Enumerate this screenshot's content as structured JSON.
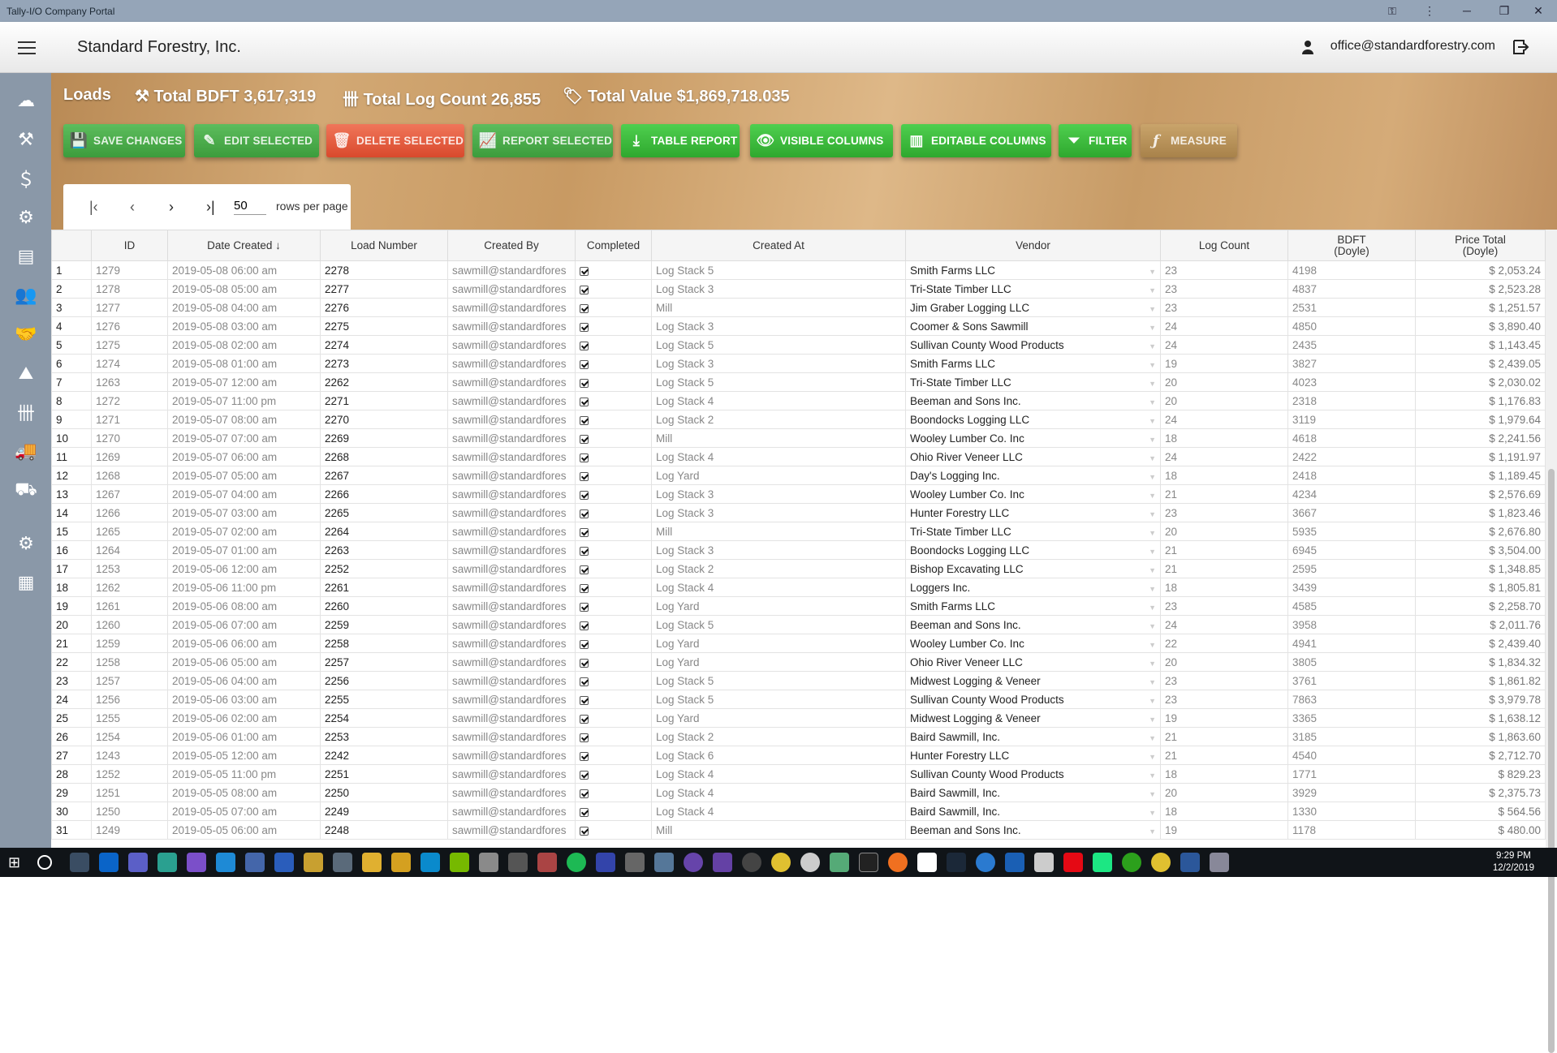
{
  "window": {
    "title": "Tally-I/O Company Portal"
  },
  "header": {
    "company": "Standard Forestry, Inc.",
    "user_email": "office@standardforestry.com"
  },
  "summary": {
    "section": "Loads",
    "total_bdft": "Total BDFT 3,617,319",
    "total_log_count": "Total Log Count 26,855",
    "total_value": "Total Value $1,869,718.035"
  },
  "toolbar": {
    "save": "SAVE CHANGES",
    "edit": "EDIT SELECTED",
    "delete": "DELETE SELECTED",
    "report": "REPORT SELECTED",
    "table_report": "TABLE REPORT",
    "visible_columns": "VISIBLE COLUMNS",
    "editable_columns": "EDITABLE COLUMNS",
    "filter": "FILTER",
    "measure": "MEASURE"
  },
  "pagination": {
    "rows_per_page_value": "50",
    "rows_per_page_label": "rows per page"
  },
  "table": {
    "headers": {
      "id": "ID",
      "date_created": "Date Created",
      "load_number": "Load Number",
      "created_by": "Created By",
      "completed": "Completed",
      "created_at": "Created At",
      "vendor": "Vendor",
      "log_count": "Log Count",
      "bdft": "BDFT",
      "bdft_sub": "(Doyle)",
      "price_total": "Price Total",
      "price_sub": "(Doyle)"
    },
    "rows": [
      [
        "1",
        "1279",
        "2019-05-08 06:00 am",
        "2278",
        "sawmill@standardfores",
        "Log Stack 5",
        "Smith Farms LLC",
        "23",
        "4198",
        "$ 2,053.24"
      ],
      [
        "2",
        "1278",
        "2019-05-08 05:00 am",
        "2277",
        "sawmill@standardfores",
        "Log Stack 3",
        "Tri-State Timber LLC",
        "23",
        "4837",
        "$ 2,523.28"
      ],
      [
        "3",
        "1277",
        "2019-05-08 04:00 am",
        "2276",
        "sawmill@standardfores",
        "Mill",
        "Jim Graber Logging LLC",
        "23",
        "2531",
        "$ 1,251.57"
      ],
      [
        "4",
        "1276",
        "2019-05-08 03:00 am",
        "2275",
        "sawmill@standardfores",
        "Log Stack 3",
        "Coomer & Sons Sawmill",
        "24",
        "4850",
        "$ 3,890.40"
      ],
      [
        "5",
        "1275",
        "2019-05-08 02:00 am",
        "2274",
        "sawmill@standardfores",
        "Log Stack 5",
        "Sullivan County Wood Products",
        "24",
        "2435",
        "$ 1,143.45"
      ],
      [
        "6",
        "1274",
        "2019-05-08 01:00 am",
        "2273",
        "sawmill@standardfores",
        "Log Stack 3",
        "Smith Farms LLC",
        "19",
        "3827",
        "$ 2,439.05"
      ],
      [
        "7",
        "1263",
        "2019-05-07 12:00 am",
        "2262",
        "sawmill@standardfores",
        "Log Stack 5",
        "Tri-State Timber LLC",
        "20",
        "4023",
        "$ 2,030.02"
      ],
      [
        "8",
        "1272",
        "2019-05-07 11:00 pm",
        "2271",
        "sawmill@standardfores",
        "Log Stack 4",
        "Beeman and Sons Inc.",
        "20",
        "2318",
        "$ 1,176.83"
      ],
      [
        "9",
        "1271",
        "2019-05-07 08:00 am",
        "2270",
        "sawmill@standardfores",
        "Log Stack 2",
        "Boondocks Logging LLC",
        "24",
        "3119",
        "$ 1,979.64"
      ],
      [
        "10",
        "1270",
        "2019-05-07 07:00 am",
        "2269",
        "sawmill@standardfores",
        "Mill",
        "Wooley Lumber Co. Inc",
        "18",
        "4618",
        "$ 2,241.56"
      ],
      [
        "11",
        "1269",
        "2019-05-07 06:00 am",
        "2268",
        "sawmill@standardfores",
        "Log Stack 4",
        "Ohio River Veneer LLC",
        "24",
        "2422",
        "$ 1,191.97"
      ],
      [
        "12",
        "1268",
        "2019-05-07 05:00 am",
        "2267",
        "sawmill@standardfores",
        "Log Yard",
        "Day's Logging Inc.",
        "18",
        "2418",
        "$ 1,189.45"
      ],
      [
        "13",
        "1267",
        "2019-05-07 04:00 am",
        "2266",
        "sawmill@standardfores",
        "Log Stack 3",
        "Wooley Lumber Co. Inc",
        "21",
        "4234",
        "$ 2,576.69"
      ],
      [
        "14",
        "1266",
        "2019-05-07 03:00 am",
        "2265",
        "sawmill@standardfores",
        "Log Stack 3",
        "Hunter Forestry LLC",
        "23",
        "3667",
        "$ 1,823.46"
      ],
      [
        "15",
        "1265",
        "2019-05-07 02:00 am",
        "2264",
        "sawmill@standardfores",
        "Mill",
        "Tri-State Timber LLC",
        "20",
        "5935",
        "$ 2,676.80"
      ],
      [
        "16",
        "1264",
        "2019-05-07 01:00 am",
        "2263",
        "sawmill@standardfores",
        "Log Stack 3",
        "Boondocks Logging LLC",
        "21",
        "6945",
        "$ 3,504.00"
      ],
      [
        "17",
        "1253",
        "2019-05-06 12:00 am",
        "2252",
        "sawmill@standardfores",
        "Log Stack 2",
        "Bishop Excavating LLC",
        "21",
        "2595",
        "$ 1,348.85"
      ],
      [
        "18",
        "1262",
        "2019-05-06 11:00 pm",
        "2261",
        "sawmill@standardfores",
        "Log Stack 4",
        "Loggers Inc.",
        "18",
        "3439",
        "$ 1,805.81"
      ],
      [
        "19",
        "1261",
        "2019-05-06 08:00 am",
        "2260",
        "sawmill@standardfores",
        "Log Yard",
        "Smith Farms LLC",
        "23",
        "4585",
        "$ 2,258.70"
      ],
      [
        "20",
        "1260",
        "2019-05-06 07:00 am",
        "2259",
        "sawmill@standardfores",
        "Log Stack 5",
        "Beeman and Sons Inc.",
        "24",
        "3958",
        "$ 2,011.76"
      ],
      [
        "21",
        "1259",
        "2019-05-06 06:00 am",
        "2258",
        "sawmill@standardfores",
        "Log Yard",
        "Wooley Lumber Co. Inc",
        "22",
        "4941",
        "$ 2,439.40"
      ],
      [
        "22",
        "1258",
        "2019-05-06 05:00 am",
        "2257",
        "sawmill@standardfores",
        "Log Yard",
        "Ohio River Veneer LLC",
        "20",
        "3805",
        "$ 1,834.32"
      ],
      [
        "23",
        "1257",
        "2019-05-06 04:00 am",
        "2256",
        "sawmill@standardfores",
        "Log Stack 5",
        "Midwest Logging & Veneer",
        "23",
        "3761",
        "$ 1,861.82"
      ],
      [
        "24",
        "1256",
        "2019-05-06 03:00 am",
        "2255",
        "sawmill@standardfores",
        "Log Stack 5",
        "Sullivan County Wood Products",
        "23",
        "7863",
        "$ 3,979.78"
      ],
      [
        "25",
        "1255",
        "2019-05-06 02:00 am",
        "2254",
        "sawmill@standardfores",
        "Log Yard",
        "Midwest Logging & Veneer",
        "19",
        "3365",
        "$ 1,638.12"
      ],
      [
        "26",
        "1254",
        "2019-05-06 01:00 am",
        "2253",
        "sawmill@standardfores",
        "Log Stack 2",
        "Baird Sawmill, Inc.",
        "21",
        "3185",
        "$ 1,863.60"
      ],
      [
        "27",
        "1243",
        "2019-05-05 12:00 am",
        "2242",
        "sawmill@standardfores",
        "Log Stack 6",
        "Hunter Forestry LLC",
        "21",
        "4540",
        "$ 2,712.70"
      ],
      [
        "28",
        "1252",
        "2019-05-05 11:00 pm",
        "2251",
        "sawmill@standardfores",
        "Log Stack 4",
        "Sullivan County Wood Products",
        "18",
        "1771",
        "$ 829.23"
      ],
      [
        "29",
        "1251",
        "2019-05-05 08:00 am",
        "2250",
        "sawmill@standardfores",
        "Log Stack 4",
        "Baird Sawmill, Inc.",
        "20",
        "3929",
        "$ 2,375.73"
      ],
      [
        "30",
        "1250",
        "2019-05-05 07:00 am",
        "2249",
        "sawmill@standardfores",
        "Log Stack 4",
        "Baird Sawmill, Inc.",
        "18",
        "1330",
        "$ 564.56"
      ],
      [
        "31",
        "1249",
        "2019-05-05 06:00 am",
        "2248",
        "sawmill@standardfores",
        "Mill",
        "Beeman and Sons Inc.",
        "19",
        "1178",
        "$ 480.00"
      ]
    ]
  },
  "clock": {
    "time": "9:29 PM",
    "date": "12/2/2019"
  }
}
